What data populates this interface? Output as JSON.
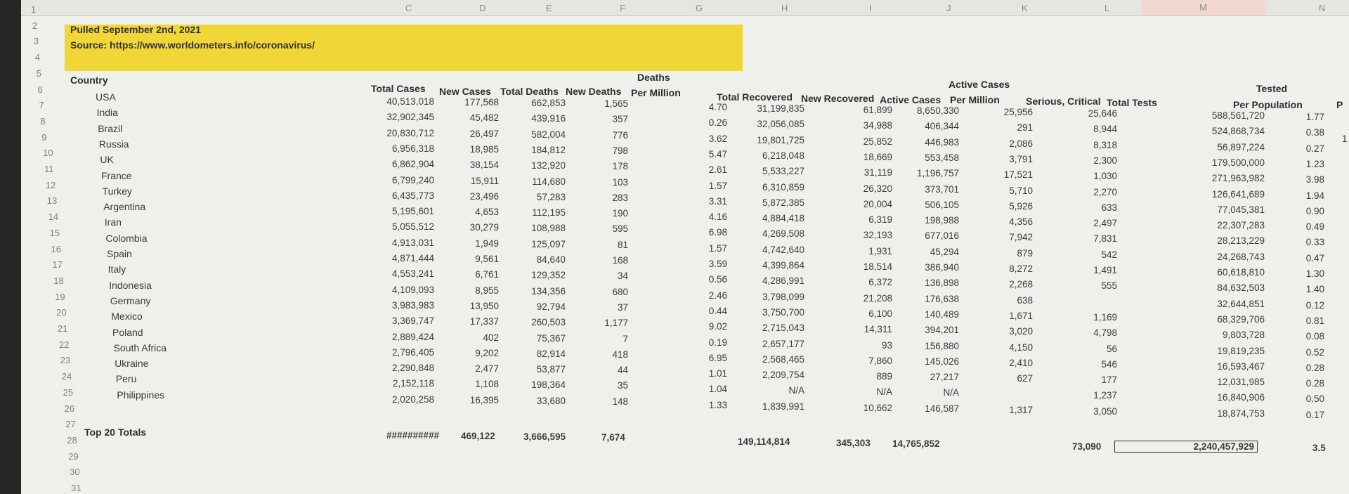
{
  "sheet": {
    "column_letters": [
      "C",
      "D",
      "E",
      "F",
      "G",
      "H",
      "I",
      "J",
      "K",
      "L",
      "M",
      "N"
    ],
    "row_numbers": [
      "1",
      "2",
      "3",
      "4",
      "5",
      "6",
      "7",
      "8",
      "9",
      "10",
      "11",
      "12",
      "13",
      "14",
      "15",
      "16",
      "17",
      "18",
      "19",
      "20",
      "21",
      "22",
      "23",
      "24",
      "25",
      "26",
      "27",
      "28",
      "29",
      "30",
      "31"
    ],
    "pulled": "Pulled September 2nd, 2021",
    "source": "Source: https://www.worldometers.info/coronavirus/",
    "headers": {
      "country": "Country",
      "total_cases": "Total Cases",
      "new_cases": "New Cases",
      "total_deaths": "Total Deaths",
      "new_deaths": "New Deaths",
      "deaths_per_million_1": "Deaths",
      "deaths_per_million_2": "Per Million",
      "total_recovered": "Total Recovered",
      "new_recovered": "New Recovered",
      "active_cases": "Active Cases",
      "active_per_million_1": "Active Cases",
      "active_per_million_2": "Per Million",
      "serious_critical": "Serious, Critical",
      "total_tests": "Total Tests",
      "tested_pop_1": "Tested",
      "tested_pop_2": "Per Population",
      "cut_col": "P"
    },
    "rows": [
      {
        "country": "USA",
        "total_cases": "40,513,018",
        "new_cases": "177,568",
        "total_deaths": "662,853",
        "new_deaths": "1,565",
        "dpm": "4.70",
        "total_recovered": "31,199,835",
        "new_recovered": "61,899",
        "active": "8,650,330",
        "active_pm": "25,956",
        "serious": "25,646",
        "tests": "588,561,720",
        "tested_pop": "1.77"
      },
      {
        "country": "India",
        "total_cases": "32,902,345",
        "new_cases": "45,482",
        "total_deaths": "439,916",
        "new_deaths": "357",
        "dpm": "0.26",
        "total_recovered": "32,056,085",
        "new_recovered": "34,988",
        "active": "406,344",
        "active_pm": "291",
        "serious": "8,944",
        "tests": "524,868,734",
        "tested_pop": "0.38"
      },
      {
        "country": "Brazil",
        "total_cases": "20,830,712",
        "new_cases": "26,497",
        "total_deaths": "582,004",
        "new_deaths": "776",
        "dpm": "3.62",
        "total_recovered": "19,801,725",
        "new_recovered": "25,852",
        "active": "446,983",
        "active_pm": "2,086",
        "serious": "8,318",
        "tests": "56,897,224",
        "tested_pop": "0.27"
      },
      {
        "country": "Russia",
        "total_cases": "6,956,318",
        "new_cases": "18,985",
        "total_deaths": "184,812",
        "new_deaths": "798",
        "dpm": "5.47",
        "total_recovered": "6,218,048",
        "new_recovered": "18,669",
        "active": "553,458",
        "active_pm": "3,791",
        "serious": "2,300",
        "tests": "179,500,000",
        "tested_pop": "1.23"
      },
      {
        "country": "UK",
        "total_cases": "6,862,904",
        "new_cases": "38,154",
        "total_deaths": "132,920",
        "new_deaths": "178",
        "dpm": "2.61",
        "total_recovered": "5,533,227",
        "new_recovered": "31,119",
        "active": "1,196,757",
        "active_pm": "17,521",
        "serious": "1,030",
        "tests": "271,963,982",
        "tested_pop": "3.98"
      },
      {
        "country": "France",
        "total_cases": "6,799,240",
        "new_cases": "15,911",
        "total_deaths": "114,680",
        "new_deaths": "103",
        "dpm": "1.57",
        "total_recovered": "6,310,859",
        "new_recovered": "26,320",
        "active": "373,701",
        "active_pm": "5,710",
        "serious": "2,270",
        "tests": "126,641,689",
        "tested_pop": "1.94"
      },
      {
        "country": "Turkey",
        "total_cases": "6,435,773",
        "new_cases": "23,496",
        "total_deaths": "57,283",
        "new_deaths": "283",
        "dpm": "3.31",
        "total_recovered": "5,872,385",
        "new_recovered": "20,004",
        "active": "506,105",
        "active_pm": "5,926",
        "serious": "633",
        "tests": "77,045,381",
        "tested_pop": "0.90"
      },
      {
        "country": "Argentina",
        "total_cases": "5,195,601",
        "new_cases": "4,653",
        "total_deaths": "112,195",
        "new_deaths": "190",
        "dpm": "4.16",
        "total_recovered": "4,884,418",
        "new_recovered": "6,319",
        "active": "198,988",
        "active_pm": "4,356",
        "serious": "2,497",
        "tests": "22,307,283",
        "tested_pop": "0.49"
      },
      {
        "country": "Iran",
        "total_cases": "5,055,512",
        "new_cases": "30,279",
        "total_deaths": "108,988",
        "new_deaths": "595",
        "dpm": "6.98",
        "total_recovered": "4,269,508",
        "new_recovered": "32,193",
        "active": "677,016",
        "active_pm": "7,942",
        "serious": "7,831",
        "tests": "28,213,229",
        "tested_pop": "0.33"
      },
      {
        "country": "Colombia",
        "total_cases": "4,913,031",
        "new_cases": "1,949",
        "total_deaths": "125,097",
        "new_deaths": "81",
        "dpm": "1.57",
        "total_recovered": "4,742,640",
        "new_recovered": "1,931",
        "active": "45,294",
        "active_pm": "879",
        "serious": "542",
        "tests": "24,268,743",
        "tested_pop": "0.47"
      },
      {
        "country": "Spain",
        "total_cases": "4,871,444",
        "new_cases": "9,561",
        "total_deaths": "84,640",
        "new_deaths": "168",
        "dpm": "3.59",
        "total_recovered": "4,399,864",
        "new_recovered": "18,514",
        "active": "386,940",
        "active_pm": "8,272",
        "serious": "1,491",
        "tests": "60,618,810",
        "tested_pop": "1.30"
      },
      {
        "country": "Italy",
        "total_cases": "4,553,241",
        "new_cases": "6,761",
        "total_deaths": "129,352",
        "new_deaths": "34",
        "dpm": "0.56",
        "total_recovered": "4,286,991",
        "new_recovered": "6,372",
        "active": "136,898",
        "active_pm": "2,268",
        "serious": "555",
        "tests": "84,632,503",
        "tested_pop": "1.40"
      },
      {
        "country": "Indonesia",
        "total_cases": "4,109,093",
        "new_cases": "8,955",
        "total_deaths": "134,356",
        "new_deaths": "680",
        "dpm": "2.46",
        "total_recovered": "3,798,099",
        "new_recovered": "21,208",
        "active": "176,638",
        "active_pm": "638",
        "serious": "",
        "tests": "32,644,851",
        "tested_pop": "0.12"
      },
      {
        "country": "Germany",
        "total_cases": "3,983,983",
        "new_cases": "13,950",
        "total_deaths": "92,794",
        "new_deaths": "37",
        "dpm": "0.44",
        "total_recovered": "3,750,700",
        "new_recovered": "6,100",
        "active": "140,489",
        "active_pm": "1,671",
        "serious": "1,169",
        "tests": "68,329,706",
        "tested_pop": "0.81"
      },
      {
        "country": "Mexico",
        "total_cases": "3,369,747",
        "new_cases": "17,337",
        "total_deaths": "260,503",
        "new_deaths": "1,177",
        "dpm": "9.02",
        "total_recovered": "2,715,043",
        "new_recovered": "14,311",
        "active": "394,201",
        "active_pm": "3,020",
        "serious": "4,798",
        "tests": "9,803,728",
        "tested_pop": "0.08"
      },
      {
        "country": "Poland",
        "total_cases": "2,889,424",
        "new_cases": "402",
        "total_deaths": "75,367",
        "new_deaths": "7",
        "dpm": "0.19",
        "total_recovered": "2,657,177",
        "new_recovered": "93",
        "active": "156,880",
        "active_pm": "4,150",
        "serious": "56",
        "tests": "19,819,235",
        "tested_pop": "0.52"
      },
      {
        "country": "South Africa",
        "total_cases": "2,796,405",
        "new_cases": "9,202",
        "total_deaths": "82,914",
        "new_deaths": "418",
        "dpm": "6.95",
        "total_recovered": "2,568,465",
        "new_recovered": "7,860",
        "active": "145,026",
        "active_pm": "2,410",
        "serious": "546",
        "tests": "16,593,467",
        "tested_pop": "0.28"
      },
      {
        "country": "Ukraine",
        "total_cases": "2,290,848",
        "new_cases": "2,477",
        "total_deaths": "53,877",
        "new_deaths": "44",
        "dpm": "1.01",
        "total_recovered": "2,209,754",
        "new_recovered": "889",
        "active": "27,217",
        "active_pm": "627",
        "serious": "177",
        "tests": "12,031,985",
        "tested_pop": "0.28"
      },
      {
        "country": "Peru",
        "total_cases": "2,152,118",
        "new_cases": "1,108",
        "total_deaths": "198,364",
        "new_deaths": "35",
        "dpm": "1.04",
        "total_recovered": "N/A",
        "new_recovered": "N/A",
        "active": "N/A",
        "active_pm": "",
        "serious": "1,237",
        "tests": "16,840,906",
        "tested_pop": "0.50"
      },
      {
        "country": "Philippines",
        "total_cases": "2,020,258",
        "new_cases": "16,395",
        "total_deaths": "33,680",
        "new_deaths": "148",
        "dpm": "1.33",
        "total_recovered": "1,839,991",
        "new_recovered": "10,662",
        "active": "146,587",
        "active_pm": "1,317",
        "serious": "3,050",
        "tests": "18,874,753",
        "tested_pop": "0.17"
      }
    ],
    "totals": {
      "label": "Top 20 Totals",
      "total_cases": "##########",
      "new_cases": "469,122",
      "total_deaths": "3,666,595",
      "new_deaths": "7,674",
      "total_recovered": "149,114,814",
      "new_recovered": "345,303",
      "active": "14,765,852",
      "serious": "73,090",
      "tests": "2,240,457,929",
      "tested_pop": "3.5"
    },
    "partial_right": [
      "1"
    ]
  }
}
